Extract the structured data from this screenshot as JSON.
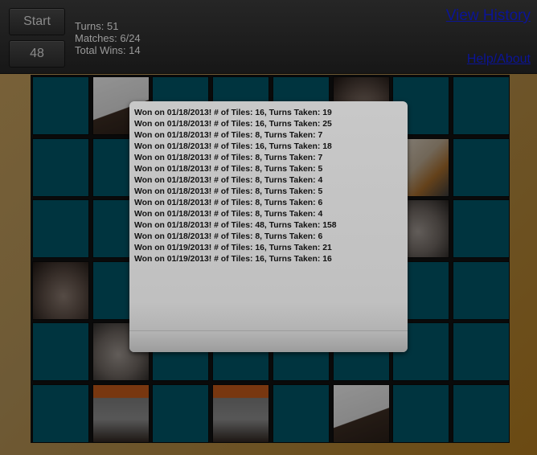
{
  "controls": {
    "start_label": "Start",
    "tile_count_label": "48"
  },
  "stats": {
    "turns": "Turns: 51",
    "matches": "Matches: 6/24",
    "total_wins": "Total Wins: 14"
  },
  "links": {
    "view_history": "View History",
    "help_about": "Help/About"
  },
  "colors": {
    "tile_back": "#005566",
    "topbar": "#1e1e1e",
    "link": "#0b1496",
    "panel": "#c0c0c0"
  },
  "board": {
    "columns": 8,
    "rows": 6,
    "revealed_tiles": [
      {
        "row": 1,
        "col": 2,
        "image": "dog-tail-photo"
      },
      {
        "row": 1,
        "col": 6,
        "image": "dog-sleeping-photo"
      },
      {
        "row": 2,
        "col": 7,
        "image": "dog-crate-photo"
      },
      {
        "row": 3,
        "col": 7,
        "image": "dog-lying-photo"
      },
      {
        "row": 4,
        "col": 1,
        "image": "dog-sleeping-photo"
      },
      {
        "row": 5,
        "col": 2,
        "image": "dog-lying-photo"
      },
      {
        "row": 6,
        "col": 2,
        "image": "dog-couch-photo"
      },
      {
        "row": 6,
        "col": 4,
        "image": "dog-couch-photo"
      },
      {
        "row": 6,
        "col": 6,
        "image": "dog-tail-photo"
      }
    ]
  },
  "history": {
    "entries": [
      "Won on 01/18/2013! # of Tiles: 16, Turns Taken: 19",
      "Won on 01/18/2013! # of Tiles: 16, Turns Taken: 25",
      "Won on 01/18/2013! # of Tiles: 8, Turns Taken: 7",
      "Won on 01/18/2013! # of Tiles: 16, Turns Taken: 18",
      "Won on 01/18/2013! # of Tiles: 8, Turns Taken: 7",
      "Won on 01/18/2013! # of Tiles: 8, Turns Taken: 5",
      "Won on 01/18/2013! # of Tiles: 8, Turns Taken: 4",
      "Won on 01/18/2013! # of Tiles: 8, Turns Taken: 5",
      "Won on 01/18/2013! # of Tiles: 8, Turns Taken: 6",
      "Won on 01/18/2013! # of Tiles: 8, Turns Taken: 4",
      "Won on 01/18/2013! # of Tiles: 48, Turns Taken: 158",
      "Won on 01/18/2013! # of Tiles: 8, Turns Taken: 6",
      "Won on 01/19/2013! # of Tiles: 16, Turns Taken: 21",
      "Won on 01/19/2013! # of Tiles: 16, Turns Taken: 16"
    ]
  }
}
